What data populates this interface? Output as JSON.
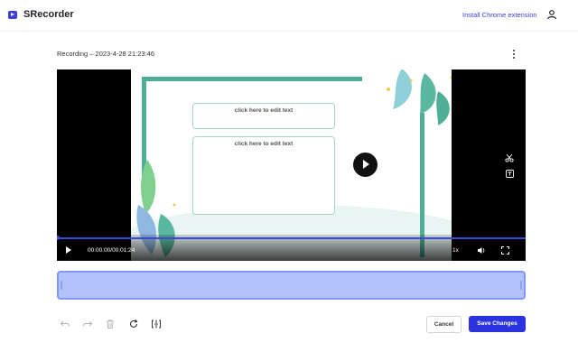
{
  "app": {
    "name": "SRecorder",
    "install_link": "Install Chrome extension"
  },
  "recording": {
    "title": "Recording – 2023-4-28 21:23:46"
  },
  "player": {
    "slide_textbox_1": "click here to edit text",
    "slide_textbox_2": "click here to edit text",
    "time": "00:00:00/00:01:24",
    "speed": "1x",
    "progress": 0.0
  },
  "actions": {
    "cancel": "Cancel",
    "save": "Save Changes"
  },
  "colors": {
    "accent": "#2a33de",
    "trim": "#b3c2fb",
    "slide_frame": "#4fae96"
  },
  "icons": [
    "logo-icon",
    "user-icon",
    "more-vertical-icon",
    "play-icon",
    "scissors-icon",
    "save-icon",
    "volume-icon",
    "fullscreen-icon",
    "undo-icon",
    "redo-icon",
    "trash-icon",
    "reset-icon",
    "split-icon"
  ]
}
